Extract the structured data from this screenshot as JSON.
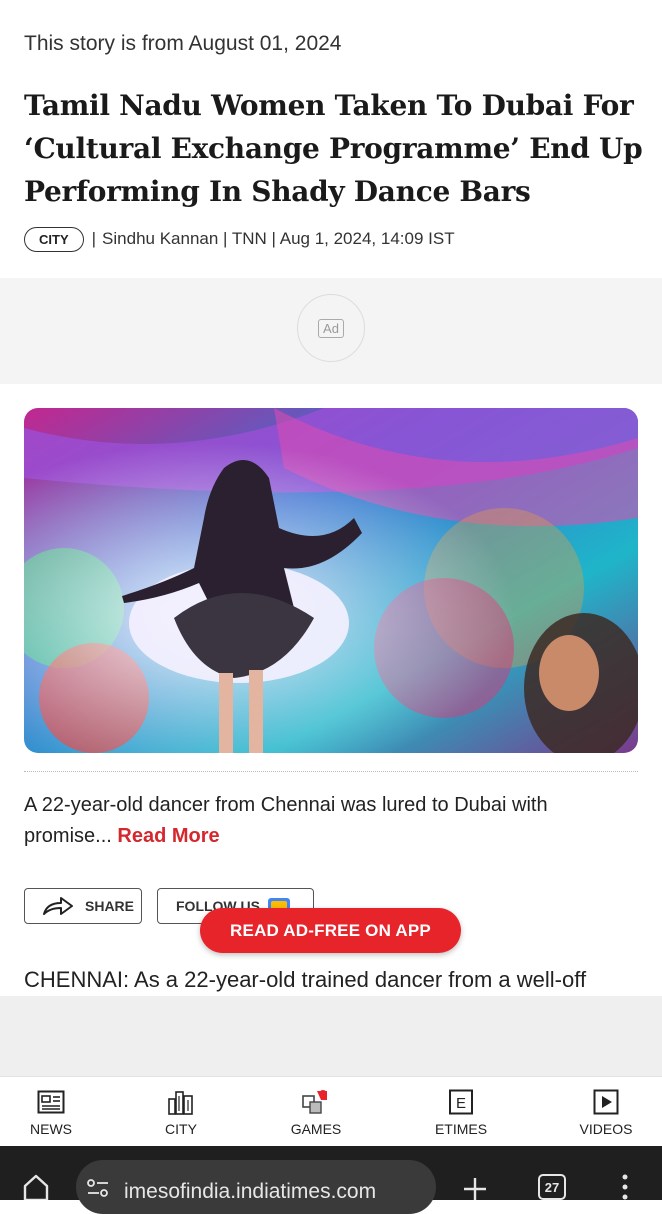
{
  "article": {
    "story_date": "This story is from August 01, 2024",
    "headline": "Tamil Nadu Women Taken To Dubai For ‘Cultural Exchange Programme’ End Up Performing In Shady Dance Bars",
    "section_tag": "CITY",
    "byline": "Sindhu Kannan | TNN | Aug 1, 2024, 14:09 IST",
    "summary": "A 22-year-old dancer from Chennai was lured to Dubai with promise...",
    "read_more": "Read More",
    "body_first_line": "CHENNAI: As a 22-year-old trained dancer from a well-off"
  },
  "ad": {
    "label": "Ad"
  },
  "actions": {
    "share": "SHARE",
    "follow": "FOLLOW US",
    "app_cta": "READ AD-FREE ON APP"
  },
  "bottom_nav": {
    "items": [
      {
        "label": "NEWS",
        "icon": "news-icon"
      },
      {
        "label": "CITY",
        "icon": "city-icon"
      },
      {
        "label": "GAMES",
        "icon": "games-icon"
      },
      {
        "label": "ETIMES",
        "icon": "etimes-icon"
      },
      {
        "label": "VIDEOS",
        "icon": "videos-icon"
      }
    ]
  },
  "browser": {
    "url": "imesofindia.indiatimes.com",
    "tab_count": "27"
  },
  "colors": {
    "accent": "#e8242b",
    "read_more": "#d4282e",
    "browser_bar": "#1f1f1f"
  }
}
